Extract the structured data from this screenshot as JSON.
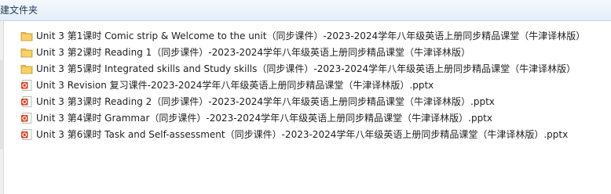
{
  "toolbar": {
    "new_folder_label": "建文件夹"
  },
  "files": [
    {
      "name": "Unit 3 第1课时 Comic strip & Welcome to the unit（同步课件）-2023-2024学年八年级英语上册同步精品课堂（牛津译林版）",
      "icon": "folder-icon"
    },
    {
      "name": "Unit 3 第2课时 Reading 1（同步课件）-2023-2024学年八年级英语上册同步精品课堂（牛津译林版）",
      "icon": "folder-icon"
    },
    {
      "name": "Unit 3 第5课时 Integrated skills and Study skills（同步课件）-2023-2024学年八年级英语上册同步精品课堂（牛津译林版）",
      "icon": "folder-icon"
    },
    {
      "name": "Unit 3 Revision 复习课件-2023-2024学年八年级英语上册同步精品课堂（牛津译林版）.pptx",
      "icon": "pptx-file-icon"
    },
    {
      "name": "Unit 3 第3课时 Reading 2（同步课件）-2023-2024学年八年级英语上册同步精品课堂（牛津译林版）.pptx",
      "icon": "pptx-file-icon"
    },
    {
      "name": "Unit 3 第4课时 Grammar（同步课件）-2023-2024学年八年级英语上册同步精品课堂（牛津译林版）.pptx",
      "icon": "pptx-file-icon"
    },
    {
      "name": "Unit 3 第6课时 Task and Self-assessment（同步课件）-2023-2024学年八年级英语上册同步精品课堂（牛津译林版）.pptx",
      "icon": "pptx-file-icon"
    }
  ],
  "colors": {
    "folder": "#e9b949",
    "pptx": "#d24726"
  }
}
